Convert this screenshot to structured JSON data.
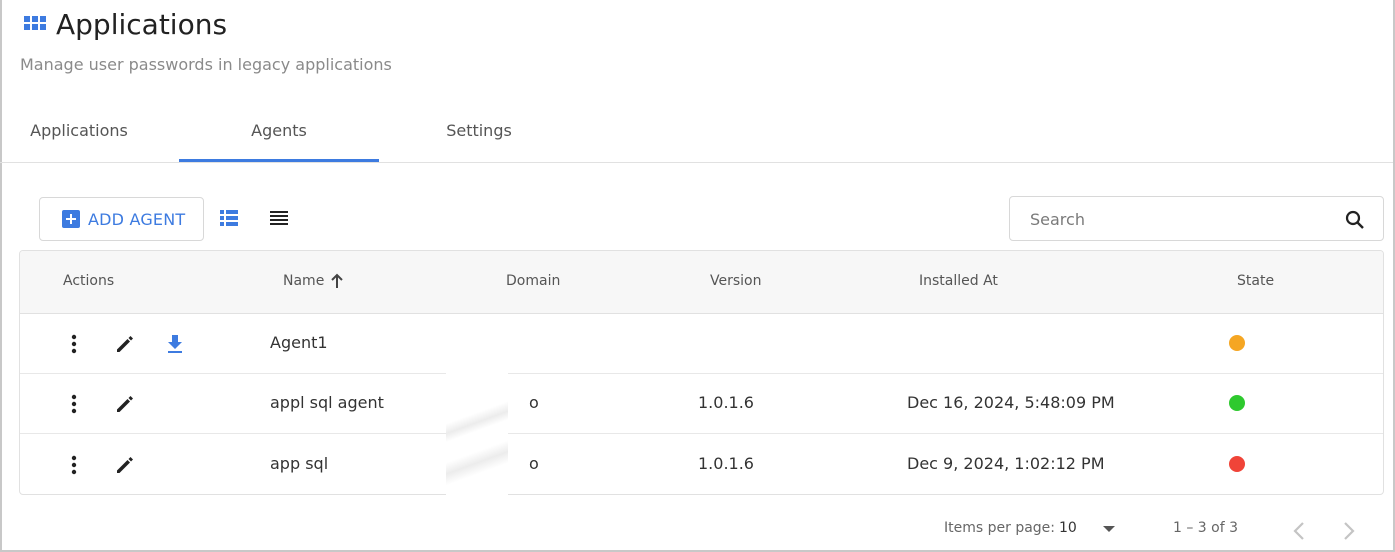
{
  "header": {
    "title": "Applications",
    "subtitle": "Manage user passwords in legacy applications",
    "icon": "apps-grid-icon"
  },
  "tabs": [
    {
      "label": "Applications",
      "active": false
    },
    {
      "label": "Agents",
      "active": true
    },
    {
      "label": "Settings",
      "active": false
    }
  ],
  "toolbar": {
    "add_label": "ADD AGENT",
    "search_placeholder": "Search"
  },
  "table": {
    "columns": [
      "Actions",
      "Name",
      "Domain",
      "Version",
      "Installed At",
      "State"
    ],
    "sort_column": "Name",
    "sort_direction": "ascending",
    "rows": [
      {
        "name": "Agent1",
        "domain": "",
        "version": "",
        "installed_at": "",
        "state": "warning",
        "state_color": "#f5a623",
        "has_download": true
      },
      {
        "name": "appl sql agent",
        "domain": "o",
        "version": "1.0.1.6",
        "installed_at": "Dec 16, 2024, 5:48:09 PM",
        "state": "online",
        "state_color": "#2ec92e",
        "has_download": false
      },
      {
        "name": "app sql",
        "domain": "o",
        "version": "1.0.1.6",
        "installed_at": "Dec 9, 2024, 1:02:12 PM",
        "state": "offline",
        "state_color": "#f04438",
        "has_download": false
      }
    ]
  },
  "pagination": {
    "items_label": "Items per page:",
    "page_size": "10",
    "range": "1 – 3 of 3"
  },
  "colors": {
    "accent": "#3d7be0"
  }
}
